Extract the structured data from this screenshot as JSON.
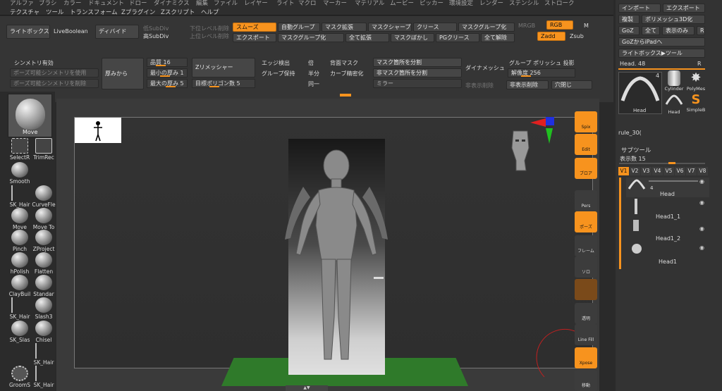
{
  "menu": {
    "row1": [
      "アルファ",
      "ブラシ",
      "カラー",
      "ドキュメント",
      "ドロー",
      "ダイナミクス",
      "編集",
      "ファイル",
      "レイヤー",
      "ライト",
      "マクロ",
      "マーカー",
      "マテリアル",
      "ムービー",
      "ピッカー",
      "環境設定",
      "レンダー",
      "ステンシル",
      "ストローク"
    ],
    "row2": [
      "テクスチャ",
      "ツール",
      "トランスフォーム",
      "Zプラグイン",
      "Zスクリプト",
      "ヘルプ"
    ]
  },
  "top": {
    "lightbox": "ライトボックス",
    "liveboolean": "LiveBoolean",
    "divide": "ディバイド",
    "lowsubdiv": "低SubDiv",
    "highsubdiv": "高SubDiv",
    "lower_level_del": "下位レベル削除",
    "higher_level_del": "上位レベル削除",
    "smooth": "スムーズ",
    "export": "エクスポート",
    "autogroup": "自動グループ",
    "mask_grow": "マスク拡張",
    "mask_sharpen": "マスクシャープ",
    "crease": "クリース",
    "mask_polygroup": "マスクグループ化",
    "all_grow": "全て拡張",
    "mask_blur": "マスクぼかし",
    "pg_crease": "PGクリース",
    "polygroup": "マスクグループ化",
    "uncrease_all": "全て解除",
    "mrgb": "MRGB",
    "rgb": "RGB",
    "m": "M",
    "zadd": "Zadd",
    "zsub": "Zsub",
    "sym_on": "シンメトリ有効",
    "pose_sym_on": "ポーズ可能シンメトリを使用",
    "pose_sym_del": "ポーズ可能シンメトリを削除",
    "thicken": "厚みから",
    "quality": "品質 16",
    "min_thick": "最小の厚み 1",
    "max_thick": "最大の厚み 5",
    "zremesher": "Zリメッシャー",
    "target_poly": "目標ポリゴン数 5",
    "edge_detect": "エッジ検出",
    "group_keep": "グループ保持",
    "double": "倍",
    "half": "半分",
    "same": "同一",
    "backface_mask": "背面マスク",
    "curve_dense": "カーブ精密化",
    "split_mask": "マスク箇所を分割",
    "split_unmask": "非マスク箇所を分割",
    "mirror": "ミラー",
    "dynamesh": "ダイナメッシュ",
    "group_poly": "グループ ポリッシュ 投影",
    "resolution": "解像度 256",
    "hide_show": "非表示削除",
    "hide_del": "非表示削除",
    "close_holes": "穴閉じ"
  },
  "leftbar": {
    "current": "Move",
    "brushes": [
      "SelectR",
      "TrimRec",
      "Smooth",
      "SK_Hair",
      "CurveFle",
      "Move",
      "Move To",
      "Pinch",
      "ZProject",
      "hPolish",
      "Flatten",
      "ClayBuil",
      "Standar",
      "SK_Hair",
      "Slash3",
      "SK_Slas",
      "Chisel",
      "SK_Hair",
      "GroomS",
      "SK_Hair"
    ]
  },
  "righttools": [
    "Spix",
    "Edit",
    "ブロア",
    "ドロー",
    "Pers",
    "ポーズ",
    "フレーム",
    "ソロ",
    "",
    "透明",
    "Line Fill",
    "Xpose",
    "移動"
  ],
  "rpanel": {
    "import": "インポート",
    "export": "エクスポート",
    "clone": "複製",
    "polymesh3d": "ポリメッシュ3D化",
    "goz": "GoZ",
    "all": "全て",
    "visible": "表示のみ",
    "r": "R",
    "goz_ipad": "GoZからiPadへ",
    "lightbox_tool": "ライトボックス▶ツール",
    "head_label": "Head. 48",
    "tool_names": [
      "Head",
      "Cylinder",
      "PolyMes",
      "Head",
      "SimpleB"
    ],
    "rule": "rule_30(",
    "num4": "4",
    "subtool_title": "サブツール",
    "visible_count": "表示数 15",
    "tabs": [
      "V1",
      "V2",
      "V3",
      "V4",
      "V5",
      "V6",
      "V7",
      "V8"
    ],
    "subtools": [
      "Head",
      "Head1_1",
      "Head1_2",
      "Head1"
    ]
  }
}
